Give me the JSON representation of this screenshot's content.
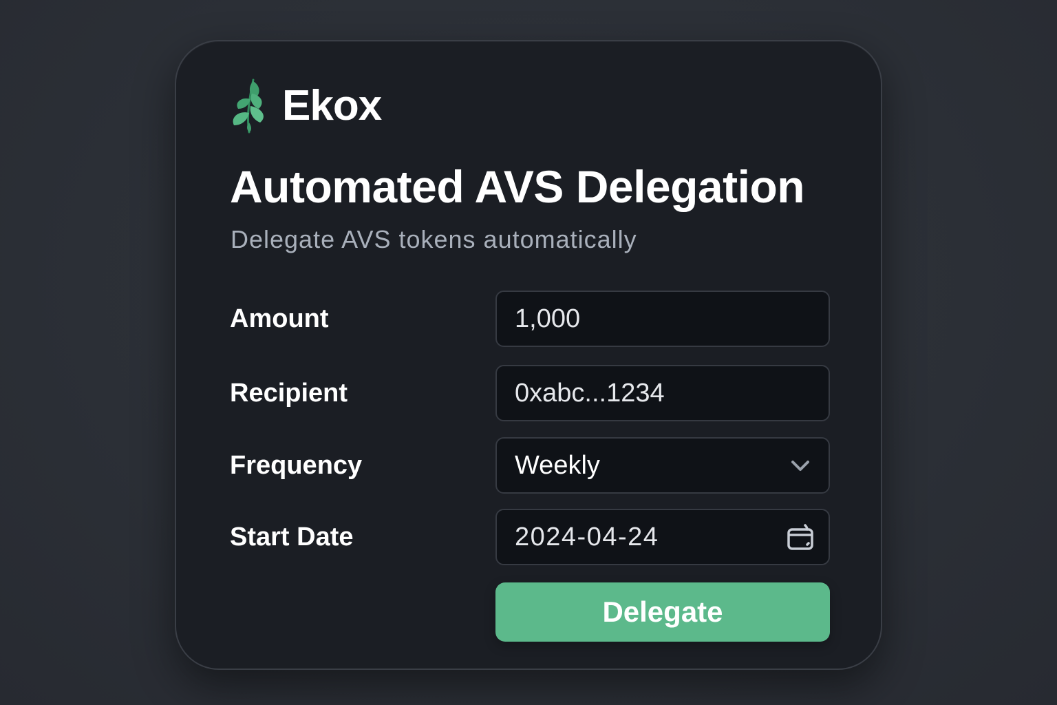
{
  "brand": {
    "name": "Ekox",
    "logo_icon": "leaf-icon",
    "accent_color": "#5cb98b"
  },
  "header": {
    "title": "Automated AVS Delegation",
    "subtitle": "Delegate AVS tokens automatically"
  },
  "form": {
    "amount": {
      "label": "Amount",
      "value": "1,000"
    },
    "recipient": {
      "label": "Recipient",
      "value": "0xabc...1234"
    },
    "frequency": {
      "label": "Frequency",
      "value": "Weekly",
      "icon": "chevron-down-icon"
    },
    "start_date": {
      "label": "Start Date",
      "value": "2024-04-24",
      "icon": "calendar-icon"
    },
    "submit_label": "Delegate"
  }
}
